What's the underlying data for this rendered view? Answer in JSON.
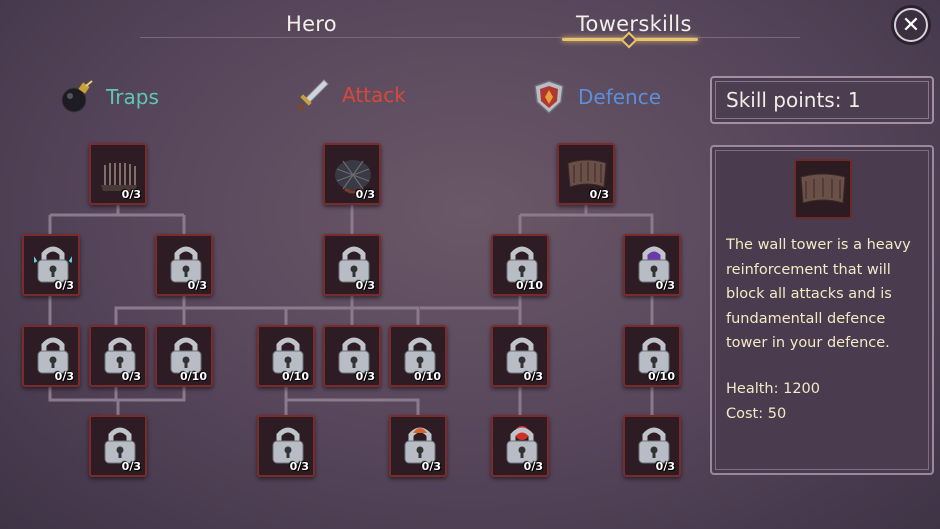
{
  "tabs": {
    "hero": "Hero",
    "towerskills": "Towerskills"
  },
  "close_icon": "close-icon",
  "categories": {
    "traps": {
      "label": "Traps",
      "color": "#5fc7b0",
      "icon": "bomb-icon"
    },
    "attack": {
      "label": "Attack",
      "color": "#d8473a",
      "icon": "sword-icon"
    },
    "defence": {
      "label": "Defence",
      "color": "#5a8fdc",
      "icon": "shield-icon"
    }
  },
  "skill_points_label": "Skill points: 1",
  "info": {
    "description": "The wall tower is a heavy reinforcement that will block all attacks and is fundamentall defence tower in your defence.",
    "health": "Health: 1200",
    "cost": "Cost: 50",
    "icon": "wall-icon"
  },
  "nodes": {
    "traps_root": "0/3",
    "traps_r2a": "0/3",
    "traps_r2b": "0/3",
    "traps_r3a": "0/3",
    "traps_r3b": "0/3",
    "traps_r3c": "0/10",
    "traps_r4": "0/3",
    "attack_root": "0/3",
    "attack_r2": "0/3",
    "attack_r3a": "0/10",
    "attack_r3b": "0/3",
    "attack_r3c": "0/10",
    "attack_r4a": "0/3",
    "attack_r4b": "0/3",
    "defence_root": "0/3",
    "defence_r2a": "0/10",
    "defence_r2b": "0/3",
    "defence_r3a": "0/3",
    "defence_r3b": "0/10",
    "defence_r4a": "0/3",
    "defence_r4b": "0/3"
  }
}
